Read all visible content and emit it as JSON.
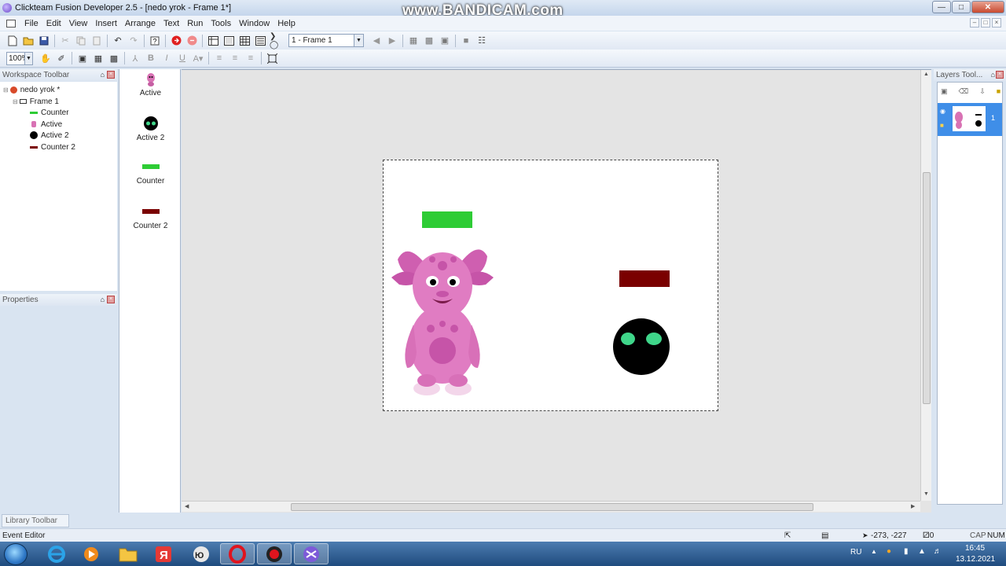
{
  "window": {
    "title": "Clickteam Fusion Developer 2.5 - [nedo yrok - Frame 1*]",
    "watermark": "www.BANDICAM.com"
  },
  "menu": [
    "File",
    "Edit",
    "View",
    "Insert",
    "Arrange",
    "Text",
    "Run",
    "Tools",
    "Window",
    "Help"
  ],
  "toolbar": {
    "frame_select": "1 - Frame 1",
    "zoom": "100%"
  },
  "workspace": {
    "header": "Workspace Toolbar",
    "tree": {
      "app": "nedo yrok *",
      "frame": "Frame 1",
      "objects": [
        "Counter",
        "Active",
        "Active 2",
        "Counter 2"
      ]
    }
  },
  "properties": {
    "header": "Properties"
  },
  "shelf": {
    "items": [
      "Active",
      "Active 2",
      "Counter",
      "Counter 2"
    ]
  },
  "layers": {
    "header": "Layers Tool...",
    "layer_number": "1"
  },
  "library_tab": "Library Toolbar",
  "status": {
    "left": "Event Editor",
    "coords": "-273, -227",
    "zero": "0",
    "caps": "CAP",
    "num": "NUM"
  },
  "taskbar": {
    "lang": "RU",
    "time": "16:45",
    "date": "13.12.2021"
  },
  "colors": {
    "counter_green": "#2ecc35",
    "counter2_red": "#7a0000",
    "active_pink": "#d872b4",
    "active2_eye": "#3fd68a"
  },
  "icons": [
    "new-icon",
    "open-icon",
    "save-icon",
    "cut-icon",
    "copy-icon",
    "paste-icon",
    "undo-icon",
    "redo-icon",
    "help-icon",
    "run-icon",
    "stop-icon"
  ]
}
